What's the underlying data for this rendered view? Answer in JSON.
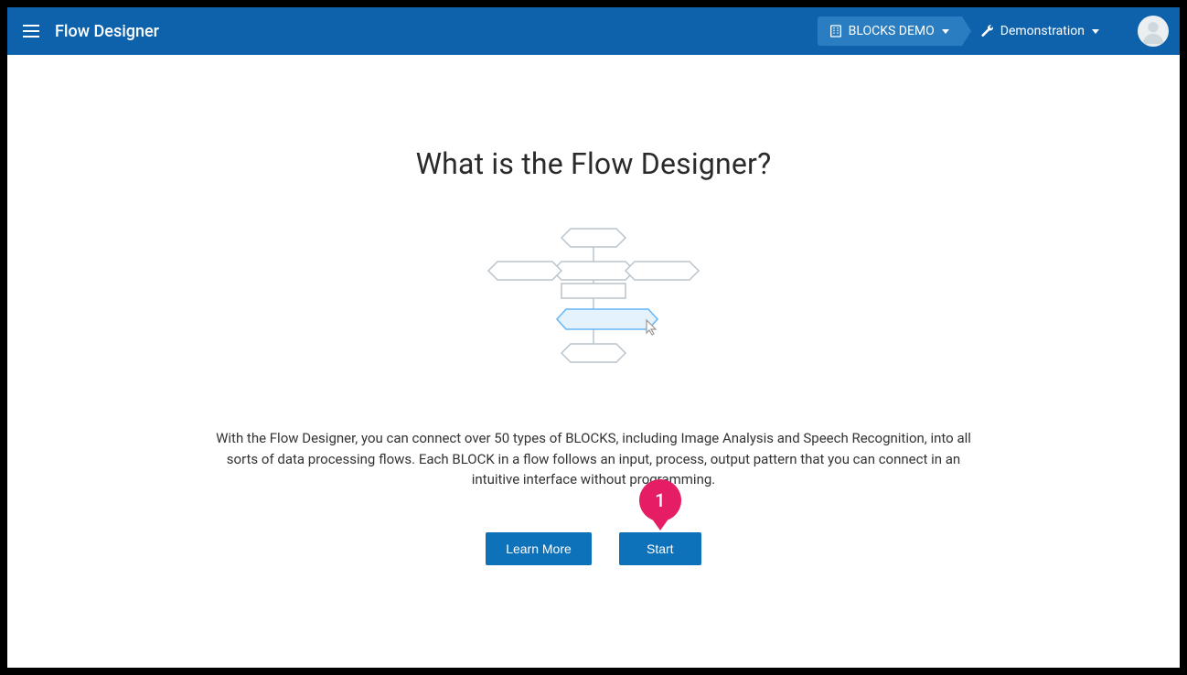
{
  "header": {
    "app_title": "Flow Designer",
    "breadcrumb": {
      "org_label": "BLOCKS DEMO",
      "project_label": "Demonstration"
    }
  },
  "hero": {
    "heading": "What is the Flow Designer?",
    "description": "With the Flow Designer, you can connect over 50 types of BLOCKS, including Image Analysis and Speech Recognition, into all sorts of data processing flows. Each BLOCK in a flow follows an input, process, output pattern that you can connect in an intuitive interface without programming.",
    "learn_more_label": "Learn More",
    "start_label": "Start"
  },
  "annotation": {
    "pin_label": "1"
  },
  "colors": {
    "header_bg": "#0d62ab",
    "button_bg": "#0d72b9",
    "pin_bg": "#e51d64"
  }
}
